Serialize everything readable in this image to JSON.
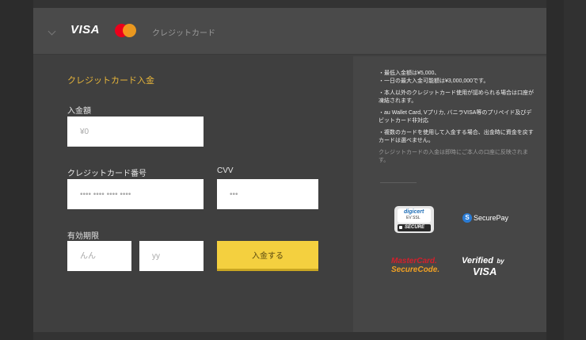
{
  "header": {
    "visa_text": "VISA",
    "tab_label": "クレジットカード"
  },
  "form": {
    "title": "クレジットカード入金",
    "amount_label": "入金額",
    "amount_placeholder": "¥0",
    "card_number_label": "クレジットカード番号",
    "card_number_placeholder": "•••• •••• •••• ••••",
    "cvv_label": "CVV",
    "cvv_placeholder": "•••",
    "expiry_label": "有効期限",
    "month_placeholder": "んん",
    "year_placeholder": "yy",
    "submit_label": "入金する"
  },
  "info": {
    "notes": [
      "・最低入金額は¥5,000、",
      "・一日の最大入金可能額は¥3,000,000です。",
      "・本人以外のクレジットカード使用が認められる場合は口座が凍結されます。",
      "・au Wallet Card, Vプリカ, バニラVISA等のプリペイド及びデビットカード非対応",
      "・複数のカードを使用して入金する場合、出金時に資金を戻すカードは選べません。"
    ],
    "muted_note": "クレジットカードの入金は即時にご本人の口座に反映されます。"
  },
  "badges": {
    "digicert_brand": "digicert",
    "digicert_ev": "EV SSL",
    "digicert_secure": "SECURE",
    "securepay_icon_letter": "S",
    "securepay_text": "SecurePay",
    "mastercard_line1": "MasterCard.",
    "mastercard_line2": "SecureCode.",
    "verified_line1": "Verified",
    "verified_by": "by",
    "verified_line2": "VISA"
  },
  "colors": {
    "accent_title": "#e8b63a",
    "submit_button": "#f4d03f",
    "panel_bg": "#3f3f3f"
  }
}
